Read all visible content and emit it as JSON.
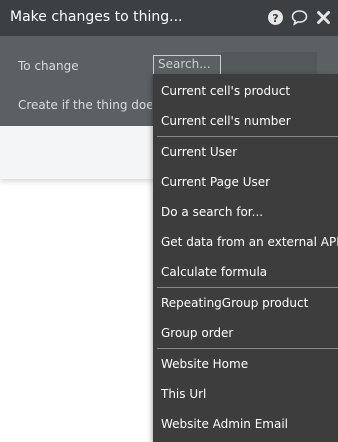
{
  "panel": {
    "title": "Make changes to thing...",
    "icons": {
      "help": "question-circle-icon",
      "comment": "comment-bubble-icon",
      "close": "close-x-icon"
    },
    "fields": {
      "to_change_label": "To change",
      "search_placeholder": "Search...",
      "create_label": "Create if the thing doesn"
    }
  },
  "dropdown": {
    "groups": [
      {
        "items": [
          "Current cell's product",
          "Current cell's number"
        ]
      },
      {
        "items": [
          "Current User",
          "Current Page User",
          "Do a search for...",
          "Get data from an external API",
          "Calculate formula"
        ]
      },
      {
        "items": [
          "RepeatingGroup product",
          "Group order"
        ]
      },
      {
        "items": [
          "Website Home",
          "This Url",
          "Website Admin Email"
        ]
      }
    ]
  },
  "colors": {
    "header_bg": "#3c4043",
    "body_bg": "#5b6064",
    "dropdown_bg": "#3d3d3d",
    "separator": "#8a8a8a"
  }
}
